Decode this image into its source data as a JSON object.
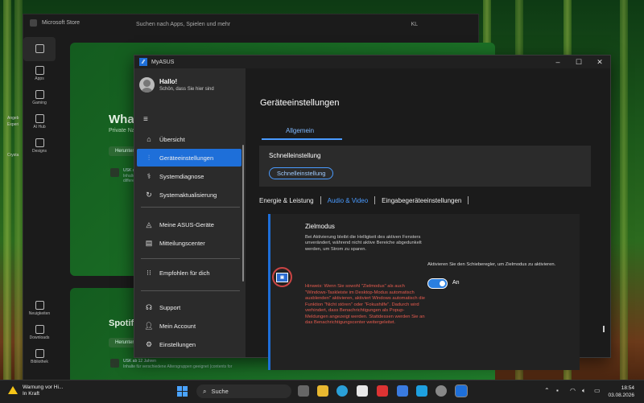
{
  "store": {
    "title": "Microsoft Store",
    "search_placeholder": "Suchen nach Apps, Spielen und mehr",
    "user_initials": "KL",
    "nav": [
      "Apps",
      "Gaming",
      "AI Hub",
      "Designs",
      "Neuigkeiten",
      "Downloads",
      "Bibliothek"
    ],
    "side_texts": [
      "Angeb",
      "Experi",
      "Crysta"
    ],
    "whatsapp": {
      "title": "WhatsApp",
      "subtitle": "Private Nachricht",
      "button": "Herunterladen",
      "usk": "USK ab 12 Jahren",
      "usk_sub1": "Inhalte für verschiedene",
      "usk_sub2": "differenzl age geeignet"
    },
    "spotify": {
      "title": "Spotify - Mu",
      "button": "Herunterladen",
      "usk": "USK ab 12 Jahren",
      "usk_sub": "Inhalte für verschiedene Altersgruppen geeignet (contents for"
    }
  },
  "app": {
    "title": "MyASUS",
    "user": {
      "greeting": "Hallo!",
      "subtitle": "Schön, dass Sie hier sind"
    },
    "nav": [
      {
        "label": "Übersicht",
        "icon": "home-icon"
      },
      {
        "label": "Geräteeinstellungen",
        "icon": "sliders-icon"
      },
      {
        "label": "Systemdiagnose",
        "icon": "stethoscope-icon"
      },
      {
        "label": "Systemaktualisierung",
        "icon": "refresh-icon"
      },
      {
        "label": "Meine ASUS-Geräte",
        "icon": "devices-icon"
      },
      {
        "label": "Mitteilungscenter",
        "icon": "bell-icon"
      },
      {
        "label": "Empfohlen für dich",
        "icon": "grid-icon"
      },
      {
        "label": "Support",
        "icon": "headset-icon"
      },
      {
        "label": "Mein Account",
        "icon": "person-icon"
      },
      {
        "label": "Einstellungen",
        "icon": "gear-icon"
      }
    ],
    "page_title": "Geräteeinstellungen",
    "tab": "Allgemein",
    "quick": {
      "title": "Schnelleinstellung",
      "button": "Schnelleinstellung"
    },
    "section_tabs": [
      "Energie & Leistung",
      "Audio & Video",
      "Eingabegeräteeinstellungen"
    ],
    "zielmodus": {
      "title": "Zielmodus",
      "description": "Bei Aktivierung bleibt die Helligkeit des aktiven Fensters unverändert, während nicht aktive Bereiche abgedunkelt werden, um Strom zu sparen.",
      "hint": "Hinweis: Wenn Sie sowohl \"Zielmodus\" als auch \"Windows-Taskleiste im Desktop-Modus automatisch ausblenden\" aktivieren, aktiviert Windows automatisch die Funktion \"Nicht stören\" oder \"Fokushilfe\". Dadurch wird verhindert, dass Benachrichtigungen als Popup-Meldungen angezeigt werden. Stattdessen werden Sie an das Benachrichtigungscenter weitergeleitet.",
      "slider_text": "Aktivieren Sie den Schieberegler, um Zielmodus zu aktivieren.",
      "toggle_label": "An",
      "toggle_on": true
    }
  },
  "taskbar": {
    "warning_title": "Warnung vor Hi...",
    "warning_sub": "In Kraft",
    "search": "Suche",
    "time": "18:54",
    "date": "03.08.2026"
  }
}
